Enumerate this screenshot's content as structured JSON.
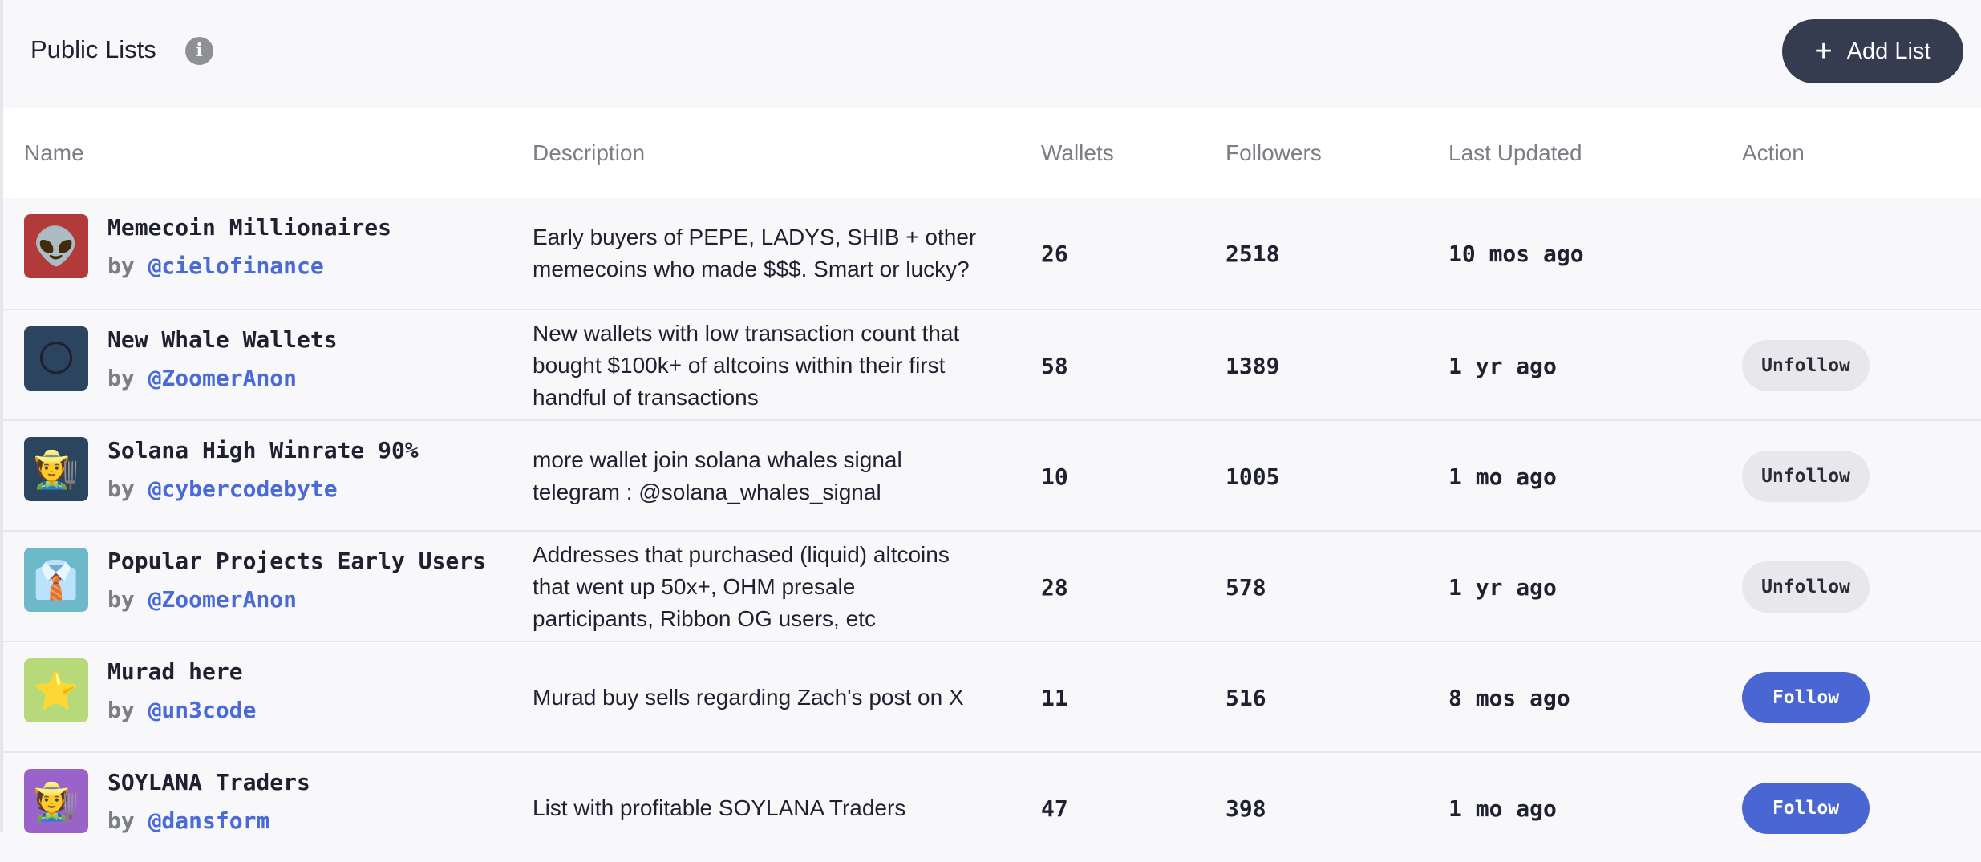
{
  "header": {
    "title": "Public Lists",
    "info_icon": "i",
    "add_button": {
      "plus": "+",
      "label": "Add List"
    }
  },
  "columns": {
    "name": "Name",
    "description": "Description",
    "wallets": "Wallets",
    "followers": "Followers",
    "last_updated": "Last Updated",
    "action": "Action"
  },
  "rows": [
    {
      "avatar_emoji": "👽",
      "avatar_bg": "#b23a3a",
      "name": "Memecoin Millionaires",
      "by": "by",
      "handle": "@cielofinance",
      "desc": [
        "Early buyers of PEPE, LADYS, SHIB + other",
        "memecoins who made $$$. Smart or lucky?"
      ],
      "wallets": "26",
      "followers": "2518",
      "updated": "10 mos ago",
      "action": ""
    },
    {
      "avatar_emoji": "🌕",
      "avatar_bg": "#2b4560",
      "name": "New Whale Wallets",
      "by": "by",
      "handle": "@ZoomerAnon",
      "desc": [
        "New wallets with low transaction count that",
        "bought $100k+ of altcoins within their first",
        "handful of transactions"
      ],
      "wallets": "58",
      "followers": "1389",
      "updated": "1 yr ago",
      "action": "Unfollow"
    },
    {
      "avatar_emoji": "🧑‍🌾",
      "avatar_bg": "#2b4560",
      "name": "Solana High Winrate 90%",
      "by": "by",
      "handle": "@cybercodebyte",
      "desc": [
        "more wallet join solana whales signal",
        "telegram : @solana_whales_signal"
      ],
      "wallets": "10",
      "followers": "1005",
      "updated": "1 mo ago",
      "action": "Unfollow"
    },
    {
      "avatar_emoji": "👔",
      "avatar_bg": "#6db8c9",
      "name": "Popular Projects Early Users",
      "by": "by",
      "handle": "@ZoomerAnon",
      "desc": [
        "Addresses that purchased (liquid) altcoins",
        "that went up 50x+, OHM presale",
        "participants, Ribbon OG users, etc"
      ],
      "wallets": "28",
      "followers": "578",
      "updated": "1 yr ago",
      "action": "Unfollow"
    },
    {
      "avatar_emoji": "⭐",
      "avatar_bg": "#b6d97a",
      "name": "Murad here",
      "by": "by",
      "handle": "@un3code",
      "desc": [
        "Murad buy sells regarding Zach's post on X"
      ],
      "wallets": "11",
      "followers": "516",
      "updated": "8 mos ago",
      "action": "Follow"
    },
    {
      "avatar_emoji": "🧑‍🌾",
      "avatar_bg": "#9a63c9",
      "name": "SOYLANA Traders",
      "by": "by",
      "handle": "@dansform",
      "desc": [
        "List with profitable SOYLANA Traders"
      ],
      "wallets": "47",
      "followers": "398",
      "updated": "1 mo ago",
      "action": "Follow"
    }
  ]
}
